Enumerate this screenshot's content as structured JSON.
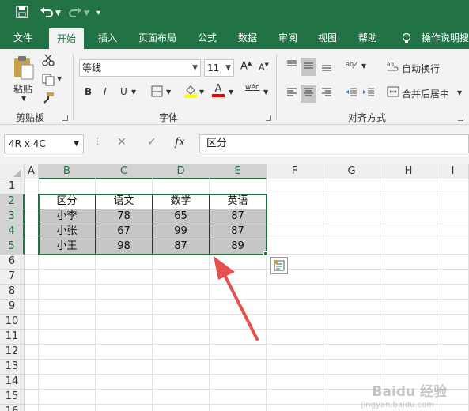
{
  "quick_access": {
    "save_icon": "save-icon",
    "undo_icon": "undo-icon",
    "redo_icon": "redo-icon",
    "customize_icon": "customize-icon"
  },
  "tabs": [
    "文件",
    "开始",
    "插入",
    "页面布局",
    "公式",
    "数据",
    "审阅",
    "视图",
    "帮助"
  ],
  "active_tab": "开始",
  "tell_me": "操作说明搜",
  "clipboard": {
    "paste_label": "粘贴",
    "group_label": "剪贴板"
  },
  "font": {
    "name": "等线",
    "size": "11",
    "bold": "B",
    "italic": "I",
    "underline": "U",
    "phonetic": "wén",
    "group_label": "字体",
    "grow": "A",
    "shrink": "A",
    "font_color_letter": "A"
  },
  "alignment": {
    "wrap_text": "自动换行",
    "merge_center": "合并后居中",
    "group_label": "对齐方式"
  },
  "formula_bar": {
    "name_box": "4R x 4C",
    "cancel": "✕",
    "enter": "✓",
    "fx": "fx",
    "content": "区分"
  },
  "columns": [
    "A",
    "B",
    "C",
    "D",
    "E",
    "F",
    "G",
    "H",
    "I"
  ],
  "rows": [
    "1",
    "2",
    "3",
    "4",
    "5",
    "6",
    "7",
    "8",
    "9",
    "10",
    "11",
    "12",
    "13",
    "14",
    "15",
    "16"
  ],
  "table": {
    "header": [
      "区分",
      "语文",
      "数学",
      "英语"
    ],
    "body": [
      [
        "小李",
        "78",
        "65",
        "87"
      ],
      [
        "小张",
        "67",
        "99",
        "87"
      ],
      [
        "小王",
        "98",
        "87",
        "89"
      ]
    ]
  },
  "watermark": "Baidu 经验",
  "watermark_url": "jingyan.baidu.com",
  "colors": {
    "accent": "#217346",
    "selection": "#c6c6c6",
    "arrow": "#e8504f",
    "highlight_yellow": "#ffff00",
    "font_red": "#ff0000"
  }
}
